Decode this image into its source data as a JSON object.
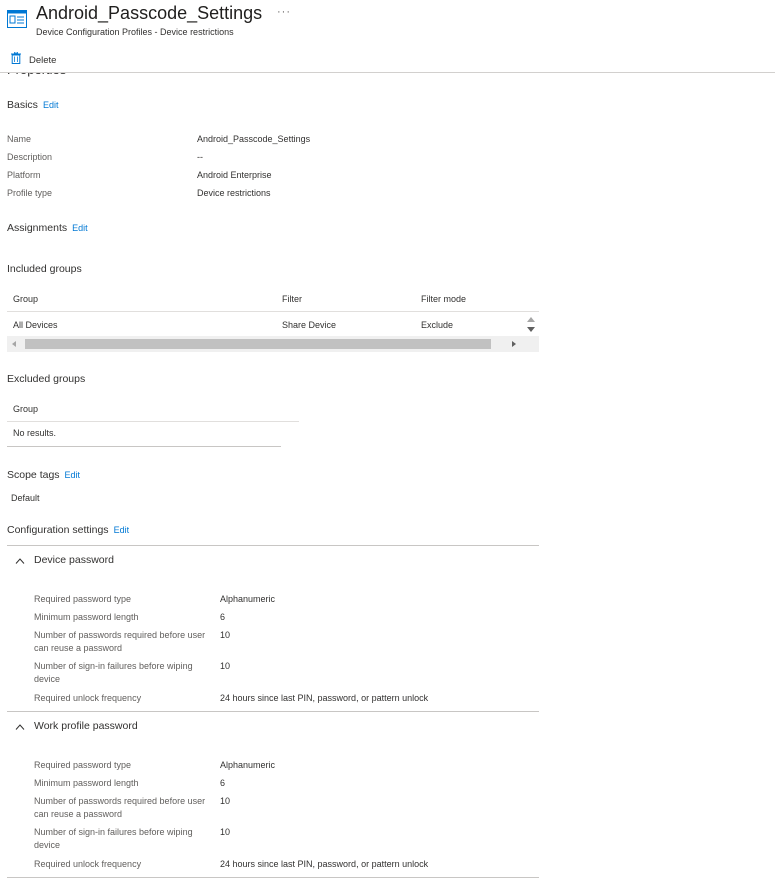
{
  "header": {
    "title": "Android_Passcode_Settings",
    "subtitle": "Device Configuration Profiles - Device restrictions",
    "more": "···"
  },
  "toolbar": {
    "delete_label": "Delete"
  },
  "properties_heading": "Properties",
  "basics": {
    "heading": "Basics",
    "edit": "Edit",
    "rows": [
      {
        "label": "Name",
        "value": "Android_Passcode_Settings"
      },
      {
        "label": "Description",
        "value": "--"
      },
      {
        "label": "Platform",
        "value": "Android Enterprise"
      },
      {
        "label": "Profile type",
        "value": "Device restrictions"
      }
    ]
  },
  "assignments": {
    "heading": "Assignments",
    "edit": "Edit",
    "included": {
      "heading": "Included groups",
      "columns": [
        "Group",
        "Filter",
        "Filter mode"
      ],
      "rows": [
        {
          "group": "All Devices",
          "filter": "Share Device",
          "mode": "Exclude"
        }
      ]
    },
    "excluded": {
      "heading": "Excluded groups",
      "columns": [
        "Group"
      ],
      "empty": "No results."
    }
  },
  "scope_tags": {
    "heading": "Scope tags",
    "edit": "Edit",
    "value": "Default"
  },
  "configuration": {
    "heading": "Configuration settings",
    "edit": "Edit",
    "sections": [
      {
        "title": "Device password",
        "rows": [
          {
            "label": "Required password type",
            "value": "Alphanumeric"
          },
          {
            "label": "Minimum password length",
            "value": "6"
          },
          {
            "label": "Number of passwords required before user can reuse a password",
            "value": "10"
          },
          {
            "label": "Number of sign-in failures before wiping device",
            "value": "10"
          },
          {
            "label": "Required unlock frequency",
            "value": "24 hours since last PIN, password, or pattern unlock"
          }
        ]
      },
      {
        "title": "Work profile password",
        "rows": [
          {
            "label": "Required password type",
            "value": "Alphanumeric"
          },
          {
            "label": "Minimum password length",
            "value": "6"
          },
          {
            "label": "Number of passwords required before user can reuse a password",
            "value": "10"
          },
          {
            "label": "Number of sign-in failures before wiping device",
            "value": "10"
          },
          {
            "label": "Required unlock frequency",
            "value": "24 hours since last PIN, password, or pattern unlock"
          }
        ]
      }
    ]
  },
  "colors": {
    "accent": "#0078d4",
    "text": "#323130",
    "muted": "#605e5c"
  }
}
